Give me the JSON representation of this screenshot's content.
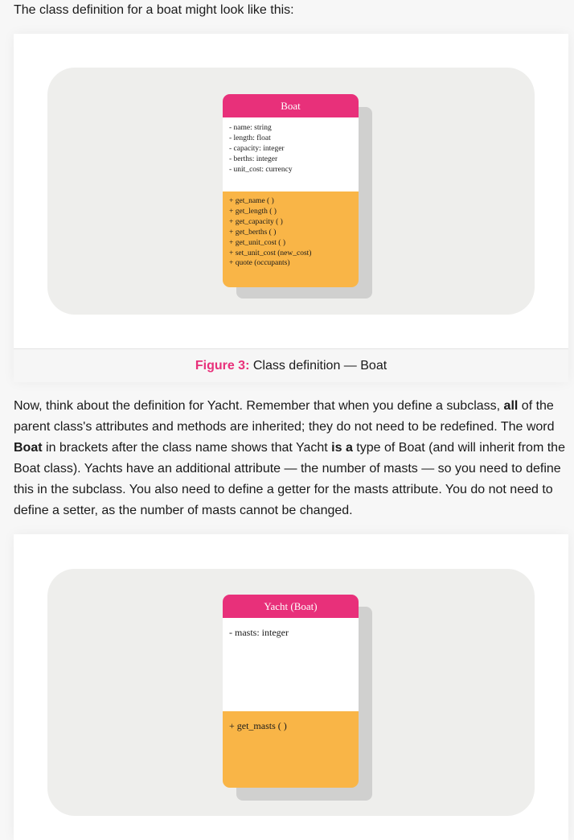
{
  "intro_text": "The class definition for a boat might look like this:",
  "figure1": {
    "class_name": "Boat",
    "attributes": [
      "- name: string",
      "- length: float",
      "- capacity: integer",
      "- berths: integer",
      "- unit_cost: currency"
    ],
    "methods": [
      "+ get_name ( )",
      "+ get_length ( )",
      "+ get_capacity ( )",
      "+ get_berths ( )",
      "+ get_unit_cost ( )",
      "+ set_unit_cost (new_cost)",
      "+ quote (occupants)"
    ],
    "caption_label": "Figure 3:",
    "caption_text": " Class definition — Boat"
  },
  "paragraph": [
    {
      "text": "Now, think about the definition for Yacht. Remember that when you define a subclass, ",
      "bold": false
    },
    {
      "text": "all",
      "bold": true
    },
    {
      "text": " of the parent class's attributes and methods are inherited; they do not need to be redefined. The word ",
      "bold": false
    },
    {
      "text": "Boat",
      "bold": true
    },
    {
      "text": " in brackets after the class name shows that Yacht ",
      "bold": false
    },
    {
      "text": "is a",
      "bold": true
    },
    {
      "text": " type of Boat (and will inherit from the Boat class). Yachts have an additional attribute — the number of masts — so you need to define this in the subclass. You also need to define a getter for the masts attribute. You do not need to define a setter, as the number of masts cannot be changed.",
      "bold": false
    }
  ],
  "figure2": {
    "class_name": "Yacht (Boat)",
    "attributes": [
      "- masts: integer"
    ],
    "methods": [
      "+ get_masts ( )"
    ]
  },
  "colors": {
    "class_header": "#e8307a",
    "methods_section": "#f9b547",
    "panel_background": "#eeeeec",
    "caption_label": "#e8307a"
  }
}
